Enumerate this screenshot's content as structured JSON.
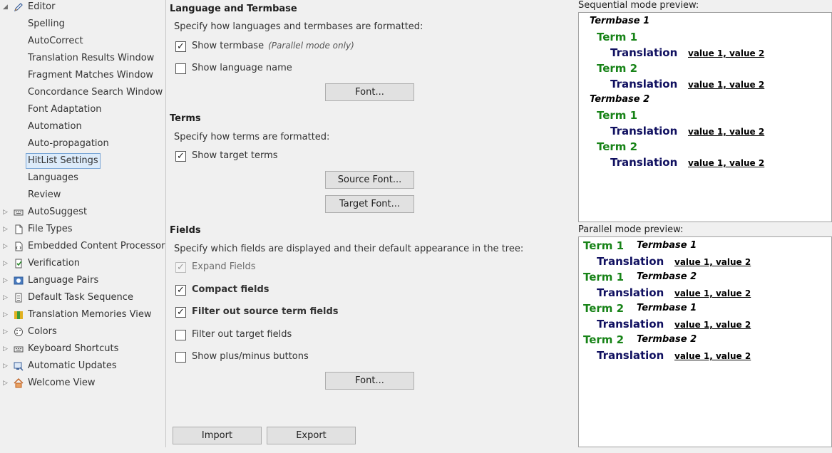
{
  "sidebar": {
    "items": [
      {
        "label": "Editor",
        "icon": "pencil-icon",
        "expanded": true
      },
      {
        "label": "Spelling"
      },
      {
        "label": "AutoCorrect"
      },
      {
        "label": "Translation Results Window"
      },
      {
        "label": "Fragment Matches Window"
      },
      {
        "label": "Concordance Search Window"
      },
      {
        "label": "Font Adaptation"
      },
      {
        "label": "Automation"
      },
      {
        "label": "Auto-propagation"
      },
      {
        "label": "HitList Settings",
        "selected": true
      },
      {
        "label": "Languages"
      },
      {
        "label": "Review"
      },
      {
        "label": "AutoSuggest",
        "icon": "keyboard-icon"
      },
      {
        "label": "File Types",
        "icon": "file-types-icon"
      },
      {
        "label": "Embedded Content Processor",
        "icon": "embedded-content-icon"
      },
      {
        "label": "Verification",
        "icon": "verification-icon"
      },
      {
        "label": "Language Pairs",
        "icon": "language-pairs-icon"
      },
      {
        "label": "Default Task Sequence",
        "icon": "task-sequence-icon"
      },
      {
        "label": "Translation Memories View",
        "icon": "translation-memories-icon"
      },
      {
        "label": "Colors",
        "icon": "palette-icon"
      },
      {
        "label": "Keyboard Shortcuts",
        "icon": "keyboard-icon"
      },
      {
        "label": "Automatic Updates",
        "icon": "updates-icon"
      },
      {
        "label": "Welcome View",
        "icon": "home-icon"
      }
    ]
  },
  "language_termbase": {
    "title": "Language and Termbase",
    "desc": "Specify how languages and termbases are formatted:",
    "show_termbase": {
      "label": "Show termbase",
      "note": "(Parallel mode only)",
      "checked": true
    },
    "show_language_name": {
      "label": "Show language name",
      "checked": false
    },
    "font_button": "Font..."
  },
  "terms": {
    "title": "Terms",
    "desc": "Specify how terms are formatted:",
    "show_target_terms": {
      "label": "Show target terms",
      "checked": true
    },
    "source_font_button": "Source Font...",
    "target_font_button": "Target Font..."
  },
  "fields": {
    "title": "Fields",
    "desc": "Specify which fields are displayed and their default appearance in the tree:",
    "expand_fields": {
      "label": "Expand Fields",
      "checked": true,
      "disabled": true
    },
    "compact_fields": {
      "label": "Compact fields",
      "checked": true
    },
    "filter_source": {
      "label": "Filter out source term fields",
      "checked": true
    },
    "filter_target": {
      "label": "Filter out target fields",
      "checked": false
    },
    "show_plus_minus": {
      "label": "Show plus/minus buttons",
      "checked": false
    },
    "font_button": "Font..."
  },
  "footer": {
    "import_label": "Import",
    "export_label": "Export"
  },
  "sequential_preview": {
    "label": "Sequential mode preview:",
    "termbase1": "Termbase 1",
    "termbase2": "Termbase 2",
    "term1": "Term 1",
    "term2": "Term 2",
    "translation": "Translation",
    "values": "value 1, value 2"
  },
  "parallel_preview": {
    "label": "Parallel mode preview:",
    "term1": "Term 1",
    "term2": "Term 2",
    "termbase1": "Termbase 1",
    "termbase2": "Termbase 2",
    "translation": "Translation",
    "values": "value 1, value 2"
  },
  "colors": {
    "term": "#178317",
    "translation": "#101060",
    "selection_border": "#7aa6d6",
    "selection_bg": "#dcebfa"
  }
}
